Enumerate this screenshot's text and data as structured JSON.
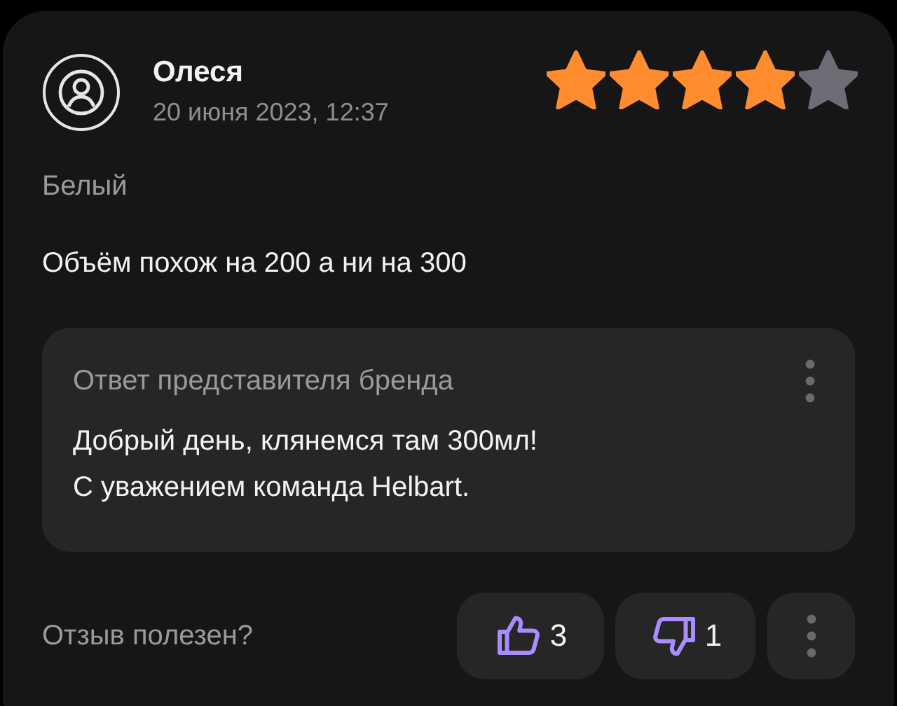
{
  "review": {
    "author": "Олеся",
    "date": "20 июня 2023, 12:37",
    "stars": 4,
    "variant": "Белый",
    "text": "Объём похож на 200 а ни на 300"
  },
  "brand_reply": {
    "title": "Ответ представителя бренда",
    "lines": [
      "Добрый день, клянемся там 300мл!",
      "С уважением команда Helbart."
    ]
  },
  "footer": {
    "question": "Отзыв полезен?",
    "likes": "3",
    "dislikes": "1"
  }
}
